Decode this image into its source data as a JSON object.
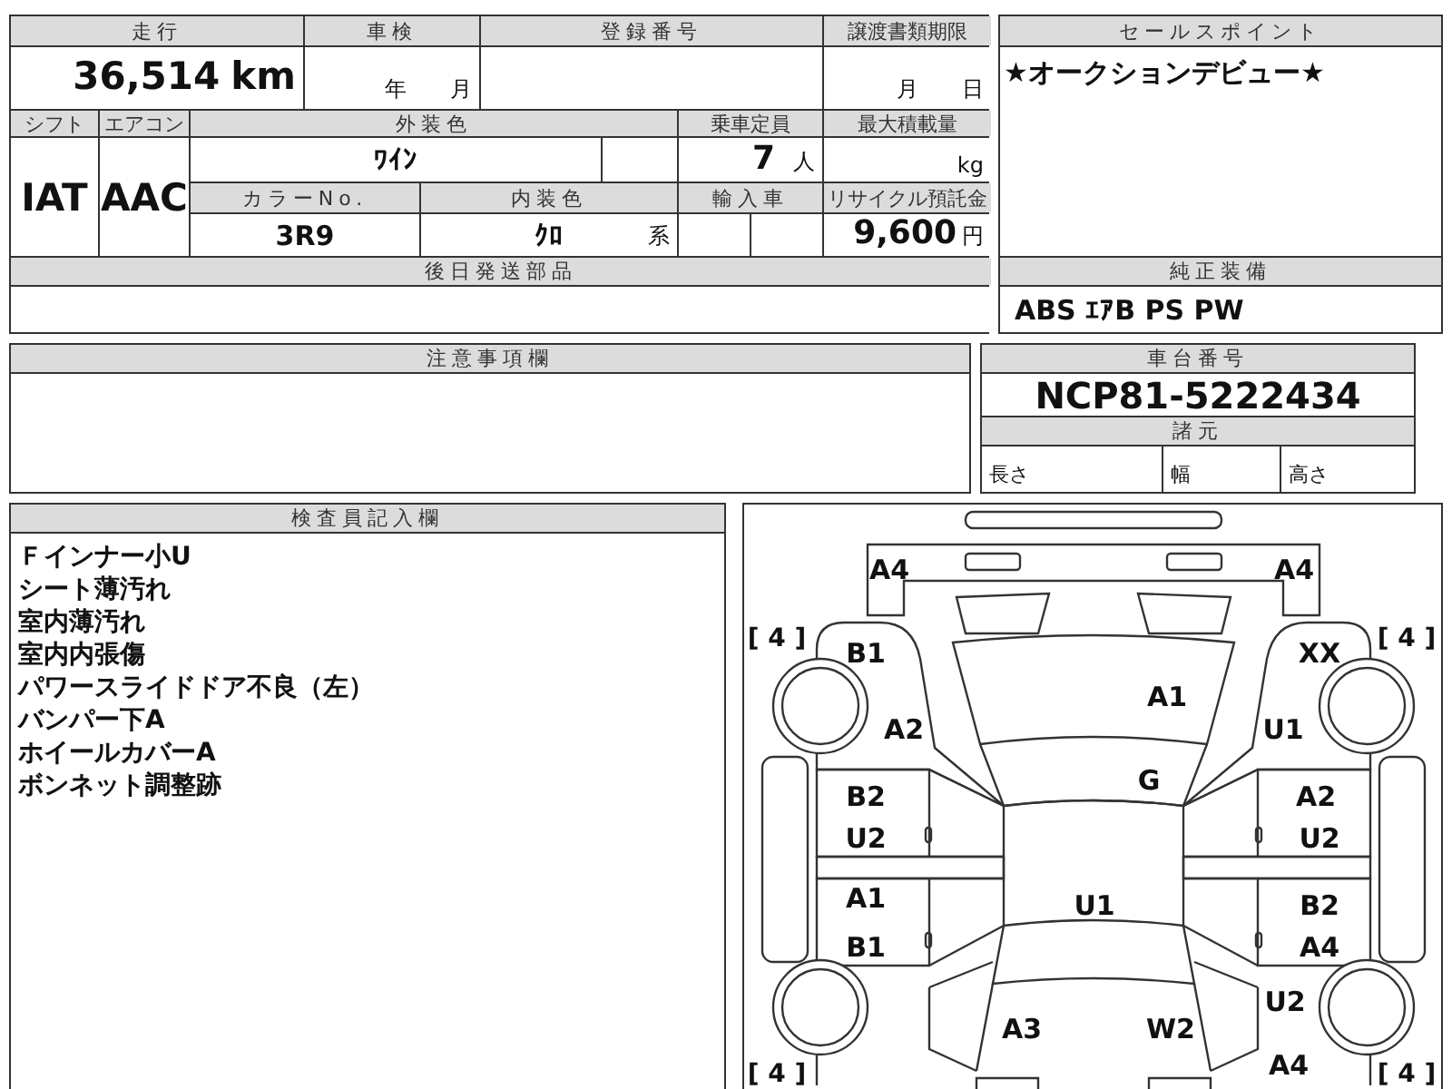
{
  "mileage": {
    "label": "走行",
    "value": "36,514",
    "unit": "km"
  },
  "inspection": {
    "label": "車検",
    "year_unit": "年",
    "month_unit": "月"
  },
  "registration_number": {
    "label": "登録番号"
  },
  "transfer_deadline": {
    "label": "譲渡書類期限",
    "month_unit": "月",
    "day_unit": "日"
  },
  "shift": {
    "label": "シフト",
    "value": "IAT"
  },
  "aircon": {
    "label": "エアコン",
    "value": "AAC"
  },
  "exterior_color": {
    "label": "外装色",
    "value": "ﾜｲﾝ"
  },
  "capacity": {
    "label": "乗車定員",
    "value": "7",
    "unit": "人"
  },
  "max_load": {
    "label": "最大積載量",
    "unit": "kg"
  },
  "color_no": {
    "label": "カラーNo.",
    "value": "3R9"
  },
  "interior_color": {
    "label": "内装色",
    "value": "ｸﾛ",
    "suffix": "系"
  },
  "import_car": {
    "label": "輸入車"
  },
  "recycle_fee": {
    "label": "リサイクル預託金",
    "value": "9,600",
    "unit": "円"
  },
  "later_parts": {
    "label": "後日発送部品"
  },
  "sales_point": {
    "label": "セールスポイント",
    "text": "★オークションデビュー★"
  },
  "equipment": {
    "label": "純正装備",
    "text": "ABS ｴｱB PS PW"
  },
  "notes": {
    "label": "注意事項欄"
  },
  "chassis": {
    "label": "車台番号",
    "value": "NCP81-5222434"
  },
  "specs": {
    "label": "諸元",
    "fields": [
      "長さ",
      "幅",
      "高さ"
    ]
  },
  "inspector": {
    "label": "検査員記入欄",
    "lines": [
      "Ｆインナー小U",
      "シート薄汚れ",
      "室内薄汚れ",
      "室内内張傷",
      "パワースライドドア不良（左）",
      "バンパー下A",
      "ホイールカバーA",
      "ボンネット調整跡"
    ]
  },
  "diagram": {
    "tire_marks": [
      "[ 4 ]",
      "[ 4 ]",
      "[ 4 ]",
      "[ 4 ]"
    ],
    "marks": [
      "A4",
      "A4",
      "B1",
      "XX",
      "A1",
      "A2",
      "U1",
      "G",
      "B2",
      "A2",
      "U2",
      "U2",
      "A1",
      "U1",
      "B2",
      "B1",
      "A4",
      "U2",
      "A3",
      "W2",
      "A4"
    ]
  }
}
